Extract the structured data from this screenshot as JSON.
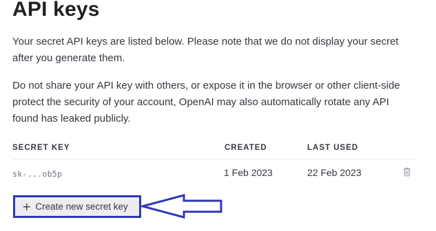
{
  "page": {
    "title": "API keys"
  },
  "intro": {
    "paragraph_1": [
      "Your secret API keys are listed below. Please note that we do not display your secret",
      "after you generate them."
    ],
    "paragraph_2": [
      "Do not share your API key with others, or expose it in the browser or other client-side",
      "protect the security of your account, OpenAI may also automatically rotate any API",
      "found has leaked publicly."
    ]
  },
  "table": {
    "headers": {
      "secret_key": "SECRET KEY",
      "created": "CREATED",
      "last_used": "LAST USED"
    },
    "rows": [
      {
        "secret_key": "sk-...ob5p",
        "created": "1 Feb 2023",
        "last_used": "22 Feb 2023",
        "action_icon": "trash-icon"
      }
    ]
  },
  "actions": {
    "create_icon": "plus-icon",
    "create_label": "Create new secret key"
  },
  "annotation": {
    "highlight_color": "#2f37b8"
  },
  "colors": {
    "text": "#353740",
    "muted": "#6e6e80",
    "button_bg": "#ececf1"
  }
}
